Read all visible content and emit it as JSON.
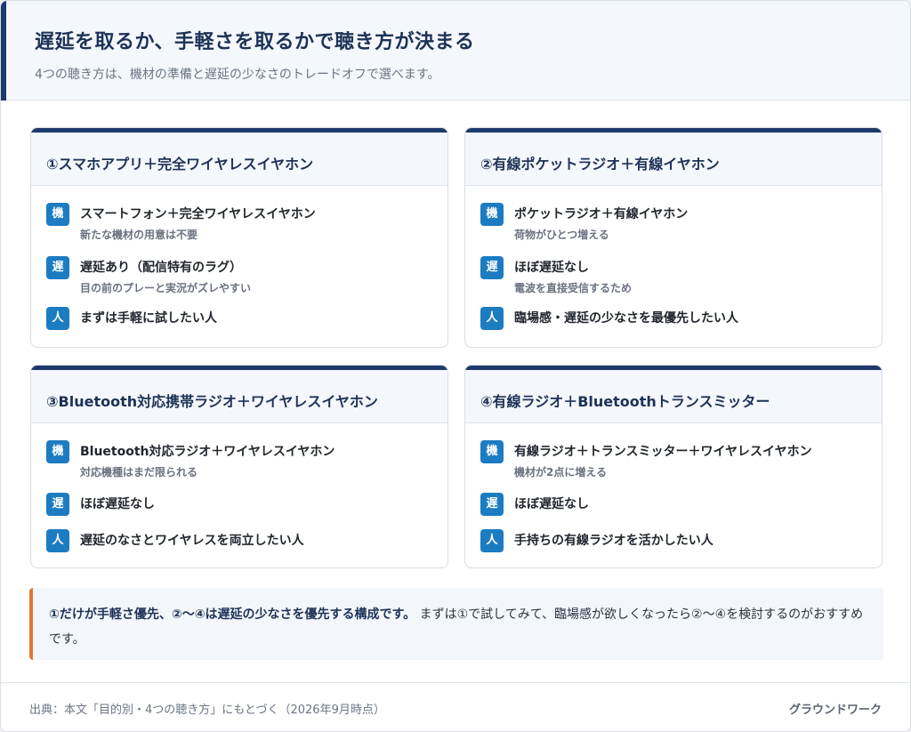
{
  "header": {
    "title": "遅延を取るか、手軽さを取るかで聴き方が決まる",
    "subtitle": "4つの聴き方は、機材の準備と遅延の少なさのトレードオフで選べます。"
  },
  "badges": {
    "equipment": "機",
    "latency": "遅",
    "person": "人"
  },
  "cards": [
    {
      "title": "①スマホアプリ＋完全ワイヤレスイヤホン",
      "equipment": "スマートフォン＋完全ワイヤレスイヤホン",
      "equipment_note": "新たな機材の用意は不要",
      "latency": "遅延あり（配信特有のラグ）",
      "latency_note": "目の前のプレーと実況がズレやすい",
      "person": "まずは手軽に試したい人"
    },
    {
      "title": "②有線ポケットラジオ＋有線イヤホン",
      "equipment": "ポケットラジオ＋有線イヤホン",
      "equipment_note": "荷物がひとつ増える",
      "latency": "ほぼ遅延なし",
      "latency_note": "電波を直接受信するため",
      "person": "臨場感・遅延の少なさを最優先したい人"
    },
    {
      "title": "③Bluetooth対応携帯ラジオ＋ワイヤレスイヤホン",
      "equipment": "Bluetooth対応ラジオ＋ワイヤレスイヤホン",
      "equipment_note": "対応機種はまだ限られる",
      "latency": "ほぼ遅延なし",
      "latency_note": "",
      "person": "遅延のなさとワイヤレスを両立したい人"
    },
    {
      "title": "④有線ラジオ＋Bluetoothトランスミッター",
      "equipment": "有線ラジオ＋トランスミッター＋ワイヤレスイヤホン",
      "equipment_note": "機材が2点に増える",
      "latency": "ほぼ遅延なし",
      "latency_note": "",
      "person": "手持ちの有線ラジオを活かしたい人"
    }
  ],
  "note": {
    "strong": "①だけが手軽さ優先、②〜④は遅延の少なさを優先する構成です。",
    "rest": "まずは①で試してみて、臨場感が欲しくなったら②〜④を検討するのがおすすめです。"
  },
  "footer": {
    "source": "出典：本文「目的別・4つの聴き方」にもとづく（2026年9月時点）",
    "brand": "グラウンドワーク"
  },
  "colors": {
    "navy": "#1d3a6b",
    "badge_blue": "#1c7cc2",
    "note_accent": "#e07a2e"
  }
}
